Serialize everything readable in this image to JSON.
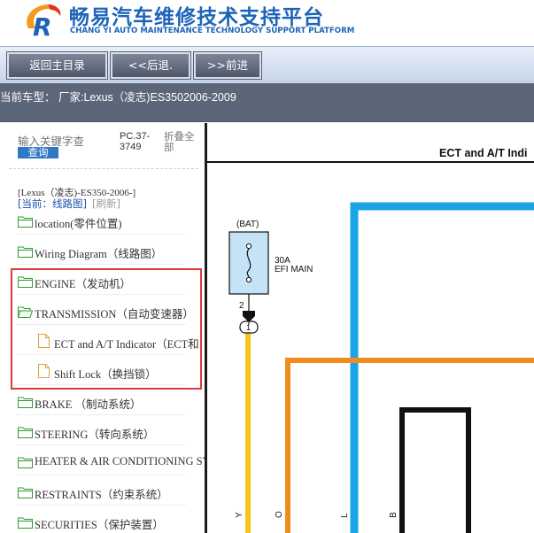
{
  "header": {
    "title": "畅易汽车维修技术支持平台",
    "subtitle": "CHANG YI AUTO MAINTENANCE TECHNOLOGY SUPPORT PLATFORM",
    "logo_icon": "changyi-logo"
  },
  "toolbar": {
    "home_label": "返回主目录",
    "back_label": "<<后退.",
    "forward_label": ">>前进"
  },
  "carbar": {
    "text": "当前车型： 厂家:Lexus（凌志)ES3502006-2009"
  },
  "sidebar": {
    "search_placeholder": "输入关键字查",
    "search_button": "查询",
    "pc_label": "PC.37-3749",
    "fold_label": "折叠全部",
    "car_line": "[Lexus（凌志)-ES350-2006-]",
    "current_label": "[当前：线路图]",
    "refresh_label": "[刷新]",
    "tree": [
      {
        "label": "location(零件位置)",
        "type": "folder"
      },
      {
        "label": "Wiring Diagram（线路图）",
        "type": "folder"
      },
      {
        "label": "ENGINE（发动机）",
        "type": "folder"
      },
      {
        "label": "TRANSMISSION（自动变速器）",
        "type": "folder-open"
      },
      {
        "label": "ECT and A/T Indicator（ECT和",
        "type": "page"
      },
      {
        "label": "Shift Lock（换挡锁）",
        "type": "page"
      },
      {
        "label": "BRAKE （制动系统）",
        "type": "folder"
      },
      {
        "label": "STEERING（转向系统）",
        "type": "folder"
      },
      {
        "label": "HEATER & AIR CONDITIONING SYS",
        "type": "folder"
      },
      {
        "label": "RESTRAINTS（约束系统）",
        "type": "folder"
      },
      {
        "label": "SECURITIES（保护装置）",
        "type": "folder"
      }
    ]
  },
  "diagram": {
    "title": "ECT and A/T Indi",
    "bat_label": "(BAT)",
    "fuse_amp": "30A",
    "fuse_name": "EFI MAIN",
    "pin_label": "2",
    "connector_label": "1",
    "wire_labels": [
      "Y",
      "O",
      "L",
      "B"
    ],
    "colors": {
      "yellow": "#f5c518",
      "blue": "#1aa3e6",
      "orange": "#f08c1e",
      "black": "#111111",
      "fuse_fill": "#c4e3f7"
    }
  }
}
